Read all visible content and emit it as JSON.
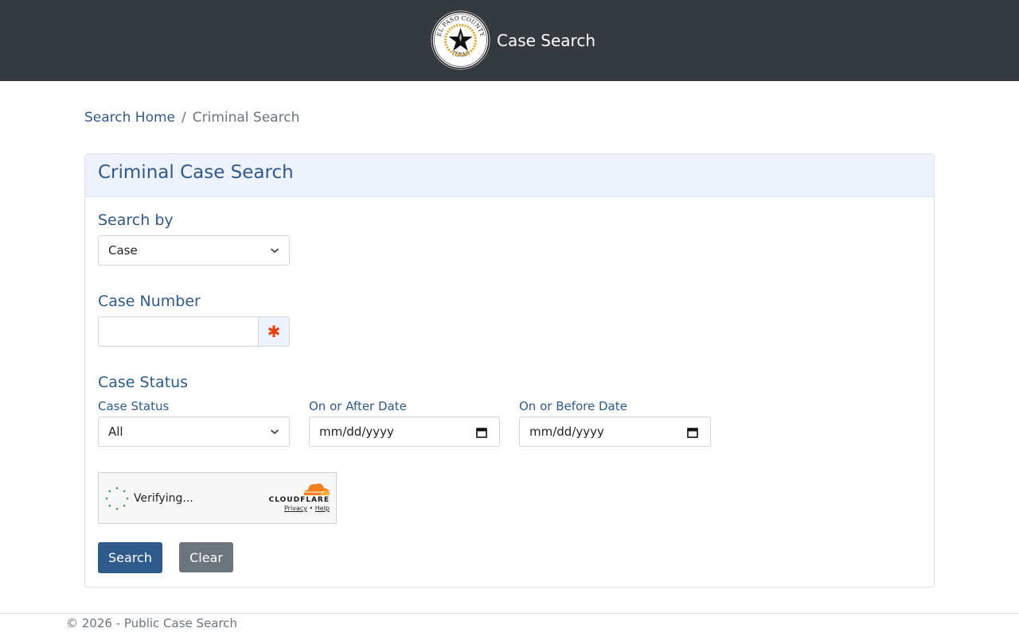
{
  "header": {
    "seal": {
      "top_text": "EL PASO COUNTY",
      "bottom_text": "TEXAS"
    },
    "title": "Case Search"
  },
  "breadcrumb": {
    "home": "Search Home",
    "separator": "/",
    "current": "Criminal Search"
  },
  "card": {
    "title": "Criminal Case Search",
    "search_by": {
      "label": "Search by",
      "value": "Case"
    },
    "case_number": {
      "label": "Case Number",
      "value": "",
      "required_marker": "✱"
    },
    "case_status_section": {
      "heading": "Case Status",
      "status": {
        "label": "Case Status",
        "value": "All"
      },
      "after_date": {
        "label": "On or After Date",
        "placeholder": "mm/dd/yyyy"
      },
      "before_date": {
        "label": "On or Before Date",
        "placeholder": "mm/dd/yyyy"
      }
    },
    "captcha": {
      "status_text": "Verifying...",
      "provider": "CLOUDFLARE",
      "privacy_link": "Privacy",
      "link_separator": "•",
      "help_link": "Help"
    },
    "buttons": {
      "search": "Search",
      "clear": "Clear"
    }
  },
  "footer": {
    "text": "© 2026 - Public Case Search"
  },
  "colors": {
    "navbar": "#343a40",
    "accent": "#2f5a8c",
    "card_header_bg": "#eef2fd",
    "required": "#e8400c",
    "secondary_button": "#6c757d",
    "cloudflare_orange": "#f38020"
  },
  "icons": {
    "seal": "county-seal-icon",
    "select_caret": "chevron-down-icon",
    "date_picker": "calendar-icon",
    "required": "asterisk-icon",
    "captcha_spinner": "spinner-icon",
    "captcha_brand": "cloudflare-cloud-icon"
  }
}
